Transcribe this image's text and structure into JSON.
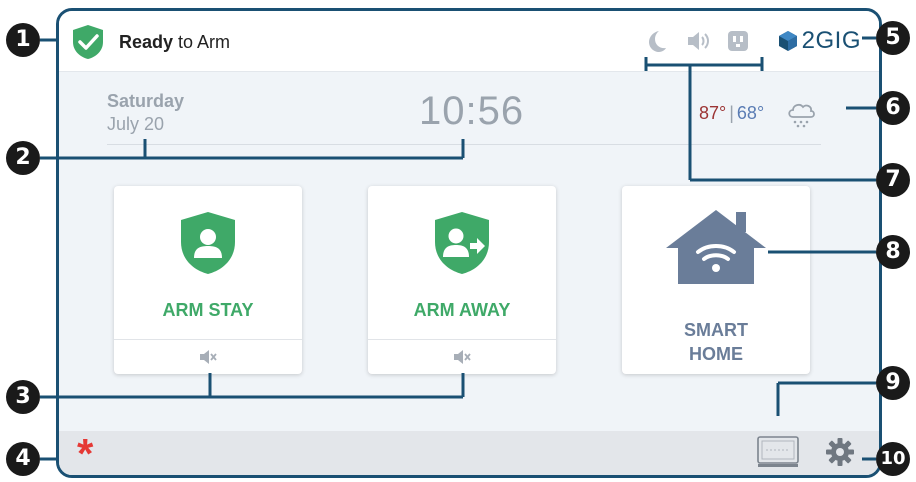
{
  "status": {
    "label_bold": "Ready",
    "label_rest": " to Arm"
  },
  "brand": {
    "name": "2GIG"
  },
  "header": {
    "day": "Saturday",
    "date": "July 20",
    "time": "10:56"
  },
  "weather": {
    "high": "87°",
    "separator": "|",
    "low": "68°",
    "icon": "cloud-snow-icon"
  },
  "top_icons": [
    "moon-icon",
    "speaker-icon",
    "outlet-icon"
  ],
  "tiles": {
    "arm_stay": {
      "label": "ARM STAY",
      "footer_icon": "mute-icon"
    },
    "arm_away": {
      "label": "ARM AWAY",
      "footer_icon": "mute-icon"
    },
    "smart_home": {
      "label_line1": "SMART",
      "label_line2": "HOME"
    }
  },
  "bottom": {
    "emergency_symbol": "*",
    "keypad_icon": "keypad-icon",
    "settings_icon": "gear-icon"
  },
  "callouts": {
    "c1": "1",
    "c2": "2",
    "c3": "3",
    "c4": "4",
    "c5": "5",
    "c6": "6",
    "c7": "7",
    "c8": "8",
    "c9": "9",
    "c10": "10"
  },
  "colors": {
    "frame": "#1a5073",
    "green": "#3fa968",
    "smart_home": "#6a7d99",
    "emergency": "#e53935",
    "temp_high": "#9c3434",
    "temp_low": "#5a7cb4"
  }
}
